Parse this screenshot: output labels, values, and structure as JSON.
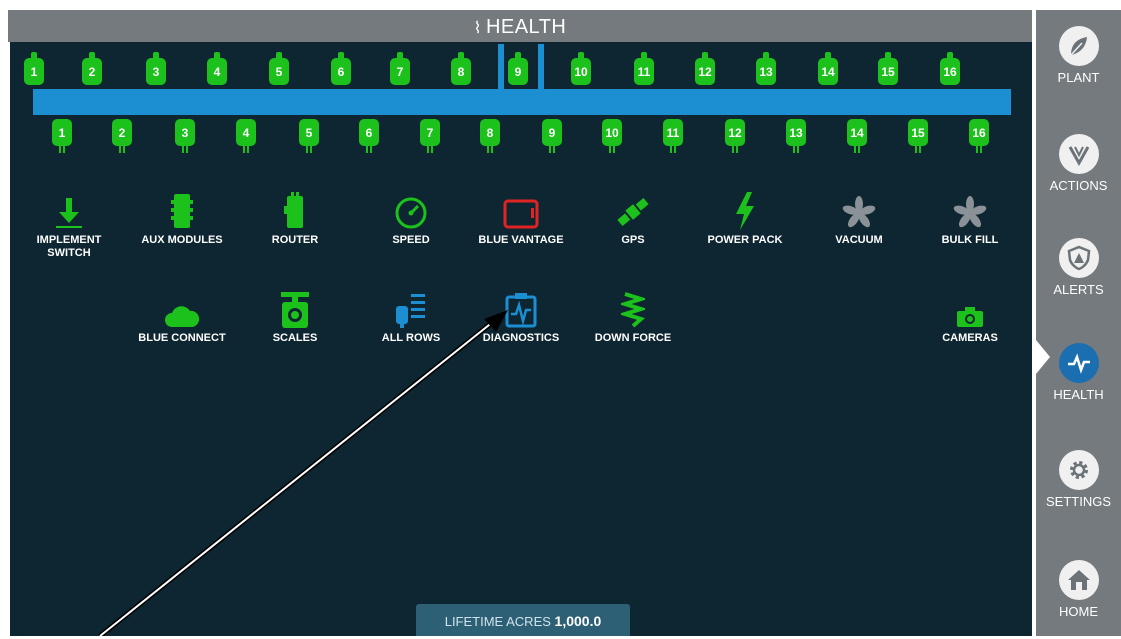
{
  "title": "HEALTH",
  "top_rows": [
    "1",
    "2",
    "3",
    "4",
    "5",
    "6",
    "7",
    "8",
    "9",
    "10",
    "11",
    "12",
    "13",
    "14",
    "15",
    "16"
  ],
  "bottom_rows": [
    "1",
    "2",
    "3",
    "4",
    "5",
    "6",
    "7",
    "8",
    "9",
    "10",
    "11",
    "12",
    "13",
    "14",
    "15",
    "16"
  ],
  "tiles_row1": [
    {
      "label": "IMPLEMENT SWITCH",
      "icon": "implement-switch-icon"
    },
    {
      "label": "AUX MODULES",
      "icon": "aux-modules-icon"
    },
    {
      "label": "ROUTER",
      "icon": "router-icon"
    },
    {
      "label": "SPEED",
      "icon": "speed-icon"
    },
    {
      "label": "BLUE VANTAGE",
      "icon": "blue-vantage-icon"
    },
    {
      "label": "GPS",
      "icon": "gps-icon"
    },
    {
      "label": "POWER PACK",
      "icon": "power-pack-icon"
    },
    {
      "label": "VACUUM",
      "icon": "vacuum-icon"
    },
    {
      "label": "BULK FILL",
      "icon": "bulk-fill-icon"
    }
  ],
  "tiles_row2": [
    {
      "label": "BLUE CONNECT",
      "icon": "blue-connect-icon"
    },
    {
      "label": "SCALES",
      "icon": "scales-icon"
    },
    {
      "label": "ALL ROWS",
      "icon": "all-rows-icon"
    },
    {
      "label": "DIAGNOSTICS",
      "icon": "diagnostics-icon"
    },
    {
      "label": "DOWN FORCE",
      "icon": "down-force-icon"
    },
    {
      "label": "CAMERAS",
      "icon": "cameras-icon"
    }
  ],
  "sidebar": [
    {
      "label": "PLANT",
      "icon": "plant-icon"
    },
    {
      "label": "ACTIONS",
      "icon": "actions-icon"
    },
    {
      "label": "ALERTS",
      "icon": "alerts-icon"
    },
    {
      "label": "HEALTH",
      "icon": "health-icon",
      "active": true
    },
    {
      "label": "SETTINGS",
      "icon": "settings-icon"
    },
    {
      "label": "HOME",
      "icon": "home-icon"
    }
  ],
  "lifetime_label": "LIFETIME ACRES",
  "lifetime_value": "1,000.0",
  "colors": {
    "background": "#0e2631",
    "title_bar": "#747a7e",
    "row_ok": "#1cc11c",
    "toolbar_blue": "#1b8fd2",
    "active_blue": "#1b6fb0",
    "alert_red": "#e02424"
  }
}
